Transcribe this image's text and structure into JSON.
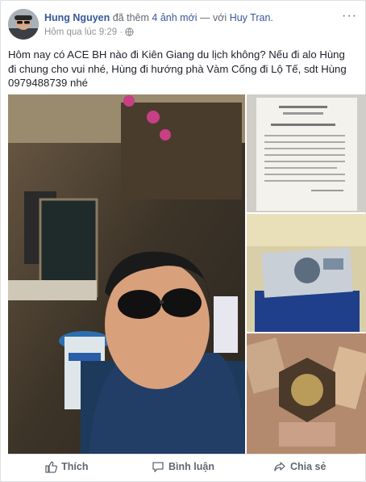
{
  "post": {
    "author": "Hung Nguyen",
    "action_text": "đã thêm",
    "photo_count_link": "4 ảnh mới",
    "with_text": "— với",
    "tagged": "Huy Tran",
    "suffix": ".",
    "timestamp": "Hôm qua lúc 9:29",
    "separator": "·",
    "privacy_icon": "globe-icon",
    "more_label": "···",
    "message": "Hôm nay có ACE BH nào đi Kiên Giang du lịch không? Nếu đi alo Hùng đi chung cho vui nhé, Hùng đi hướng phà Vàm Cống đi Lộ Tế, sdt Hùng 0979488739 nhé"
  },
  "actions": {
    "like": "Thích",
    "comment": "Bình luận",
    "share": "Chia sẻ"
  },
  "colors": {
    "link": "#365899",
    "muted": "#90949c",
    "action": "#606770"
  }
}
